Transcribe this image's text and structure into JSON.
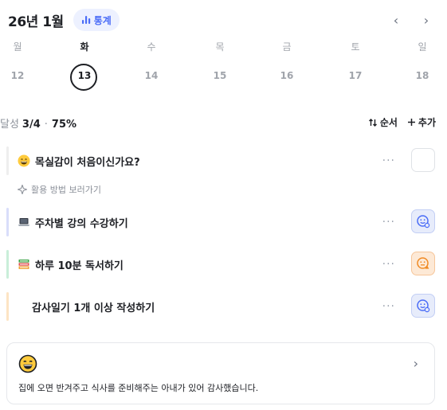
{
  "header": {
    "month": "26년 1월",
    "stats_label": "통계",
    "prev": "‹",
    "next": "›"
  },
  "week": {
    "days": [
      {
        "name": "월",
        "num": "12"
      },
      {
        "name": "화",
        "num": "13"
      },
      {
        "name": "수",
        "num": "14"
      },
      {
        "name": "목",
        "num": "15"
      },
      {
        "name": "금",
        "num": "16"
      },
      {
        "name": "토",
        "num": "17"
      },
      {
        "name": "일",
        "num": "18"
      }
    ],
    "selected_index": 1
  },
  "summary": {
    "label": "달성",
    "count": "3/4",
    "sep": "·",
    "percent": "75%"
  },
  "toolbar": {
    "order_label": "순서",
    "add_label": "추가"
  },
  "tasks": [
    {
      "title": "목실감이 처음이신가요?",
      "bar_color": "#eeeeee",
      "status": "empty"
    },
    {
      "title": "주차별 강의 수강하기",
      "bar_color": "#d9defa",
      "status": "blue"
    },
    {
      "title": "하루 10분 독서하기",
      "bar_color": "#c9eed9",
      "status": "orange"
    },
    {
      "title": "감사일기 1개 이상 작성하기",
      "bar_color": "#fde4c4",
      "status": "blue"
    }
  ],
  "guide": {
    "label": "활용 방법 보러가기"
  },
  "more": "···",
  "diary": {
    "text": "집에 오면 반겨주고 식사를 준비해주는 아내가 있어 감사했습니다."
  },
  "colors": {
    "accent": "#4a6cf7",
    "check_blue": "#4a6cf7",
    "check_orange": "#f08a24"
  }
}
